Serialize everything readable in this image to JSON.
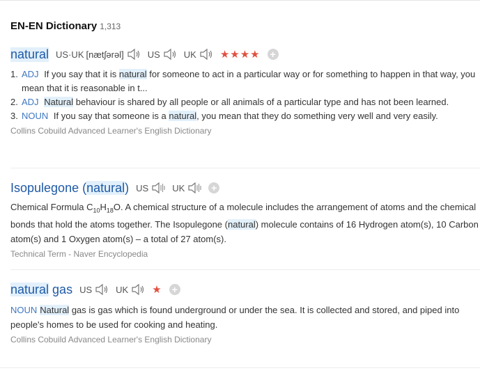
{
  "section": {
    "title": "EN-EN Dictionary",
    "count": "1,313"
  },
  "entries": [
    {
      "word": "natural",
      "pron_prefix": "US·UK",
      "ipa": "[nætʃərəl]",
      "us_label": "US",
      "uk_label": "UK",
      "stars": "★★★★",
      "plus": "+",
      "senses": [
        {
          "num": "1.",
          "pos": "ADJ",
          "pre": "If you say that it is",
          "hl": "natural",
          "post": "for someone to act in a particular way or for something to happen in that way, you mean that it is reasonable in t..."
        },
        {
          "num": "2.",
          "pos": "ADJ",
          "pre": "",
          "hl": "Natural",
          "post": "behaviour is shared by all people or all animals of a particular type and has not been learned."
        },
        {
          "num": "3.",
          "pos": "NOUN",
          "pre": "If you say that someone is a",
          "hl": "natural",
          "post": ", you mean that they do something very well and very easily."
        }
      ],
      "source": "Collins Cobuild Advanced Learner's English Dictionary"
    },
    {
      "word_pre": "Isopulegone (",
      "word_hl": "natural",
      "word_post": ")",
      "us_label": "US",
      "uk_label": "UK",
      "plus": "+",
      "def_a": "Chemical Formula C",
      "sub1": "10",
      "def_b": "H",
      "sub2": "18",
      "def_c": "O. A chemical structure of a molecule includes the arrangement of atoms and the chemical bonds that hold the atoms together. The Isopulegone (",
      "def_hl": "natural",
      "def_d": ") molecule contains of 16 Hydrogen atom(s), 10 Carbon atom(s) and 1 Oxygen atom(s) – a total of 27 atom(s).",
      "source": "Technical Term - Naver Encyclopedia"
    },
    {
      "word_hl": "natural",
      "word_post": " gas",
      "us_label": "US",
      "uk_label": "UK",
      "stars": "★",
      "plus": "+",
      "pos": "NOUN",
      "def_hl": "Natural",
      "def_post": "gas is gas which is found underground or under the sea. It is collected and stored, and piped into people's homes to be used for cooking and heating.",
      "source": "Collins Cobuild Advanced Learner's English Dictionary"
    }
  ]
}
